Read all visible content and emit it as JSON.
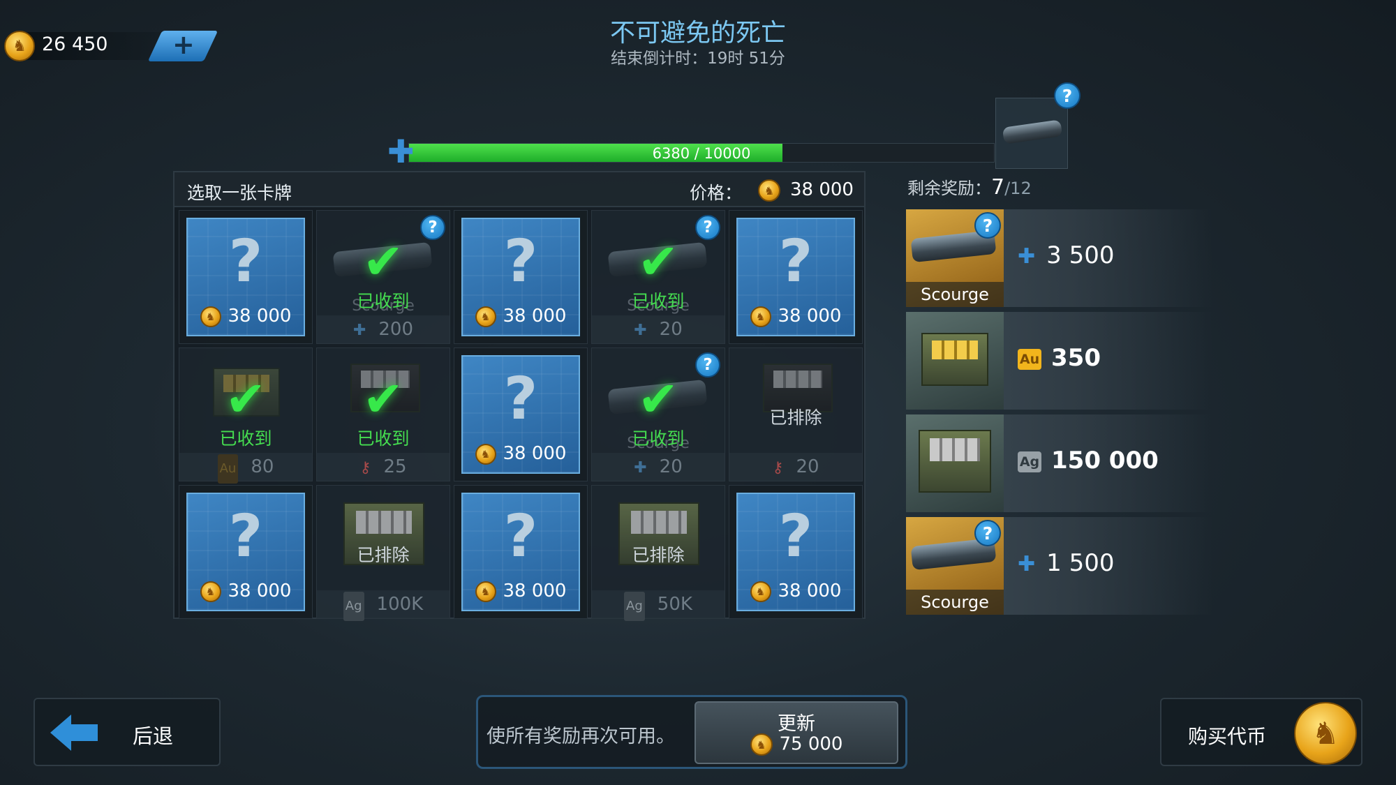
{
  "currency": {
    "amount": "26 450",
    "icon": "coin-icon",
    "add_icon": "plus-icon",
    "add_label": "+"
  },
  "header": {
    "title": "不可避免的死亡",
    "countdown": "结束倒计时：19时 51分"
  },
  "progress": {
    "text": "6380 / 10000",
    "current": 6380,
    "max": 10000,
    "icon": "puzzle-icon"
  },
  "prize": {
    "help": "?"
  },
  "panel": {
    "title": "选取一张卡牌",
    "price_label": "价格：",
    "price_value": "38 000",
    "cards": [
      {
        "state": "unknown",
        "cost": "38 000"
      },
      {
        "state": "received",
        "status": "已收到",
        "name": "Scourge",
        "amount": "200",
        "reward_icon": "puzzle-icon",
        "help": "?"
      },
      {
        "state": "unknown",
        "cost": "38 000"
      },
      {
        "state": "received",
        "status": "已收到",
        "name": "Scourge",
        "amount": "20",
        "reward_icon": "puzzle-icon",
        "help": "?"
      },
      {
        "state": "unknown",
        "cost": "38 000"
      },
      {
        "state": "received",
        "status": "已收到",
        "amount": "80",
        "reward_icon": "gold-icon",
        "badge": "Au"
      },
      {
        "state": "received",
        "status": "已收到",
        "amount": "25",
        "reward_icon": "key-icon"
      },
      {
        "state": "unknown",
        "cost": "38 000"
      },
      {
        "state": "received",
        "status": "已收到",
        "name": "Scourge",
        "amount": "20",
        "reward_icon": "puzzle-icon",
        "help": "?"
      },
      {
        "state": "excluded",
        "status": "已排除",
        "amount": "20",
        "reward_icon": "key-icon"
      },
      {
        "state": "unknown",
        "cost": "38 000"
      },
      {
        "state": "excluded",
        "status": "已排除",
        "amount": "100K",
        "reward_icon": "silver-icon",
        "badge": "Ag"
      },
      {
        "state": "unknown",
        "cost": "38 000"
      },
      {
        "state": "excluded",
        "status": "已排除",
        "amount": "50K",
        "reward_icon": "silver-icon",
        "badge": "Ag"
      },
      {
        "state": "unknown",
        "cost": "38 000"
      }
    ]
  },
  "remaining": {
    "label": "剩余奖励：",
    "current": "7",
    "total": "/12",
    "rewards": [
      {
        "name": "Scourge",
        "value": "3 500",
        "icon": "puzzle-icon",
        "help": "?"
      },
      {
        "value": "350",
        "icon": "gold-icon",
        "badge": "Au"
      },
      {
        "value": "150 000",
        "icon": "silver-icon",
        "badge": "Ag"
      },
      {
        "name": "Scourge",
        "value": "1 500",
        "icon": "puzzle-icon",
        "help": "?"
      }
    ]
  },
  "footer": {
    "back_label": "后退",
    "refresh_desc": "使所有奖励再次可用。",
    "refresh_label": "更新",
    "refresh_cost": "75 000",
    "buy_label": "购买代币"
  },
  "colors": {
    "accent_blue": "#3a8fd6",
    "progress_green": "#2fc236",
    "received_green": "#45dd50",
    "title_blue": "#7cc8f2"
  }
}
